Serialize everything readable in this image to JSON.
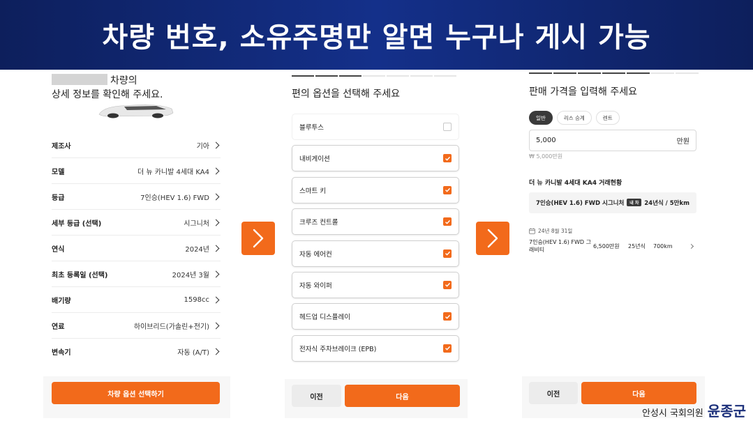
{
  "banner": {
    "title": "차량 번호, 소유주명만 알면 누구나 게시 가능"
  },
  "panel1": {
    "heading_line1": "차량의",
    "heading_line2": "상세 정보를 확인해 주세요.",
    "rows": [
      {
        "label": "제조사",
        "value": "기아"
      },
      {
        "label": "모델",
        "value": "더 뉴 카니발 4세대 KA4"
      },
      {
        "label": "등급",
        "value": "7인승(HEV 1.6) FWD"
      },
      {
        "label": "세부 등급 (선택)",
        "value": "시그니처"
      },
      {
        "label": "연식",
        "value": "2024년"
      },
      {
        "label": "최초 등록일 (선택)",
        "value": "2024년 3월"
      },
      {
        "label": "배기량",
        "value": "1598cc"
      },
      {
        "label": "연료",
        "value": "하이브리드(가솔린+전기)"
      },
      {
        "label": "변속기",
        "value": "자동 (A/T)"
      }
    ],
    "button_label": "차량 옵션 선택하기"
  },
  "panel2": {
    "title": "편의 옵션을 선택해 주세요",
    "options": [
      {
        "label": "블루투스",
        "checked": false
      },
      {
        "label": "내비게이션",
        "checked": true
      },
      {
        "label": "스마트 키",
        "checked": true
      },
      {
        "label": "크루즈 컨트롤",
        "checked": true
      },
      {
        "label": "자동 에어컨",
        "checked": true
      },
      {
        "label": "자동 와이퍼",
        "checked": true
      },
      {
        "label": "헤드업 디스플레이",
        "checked": true
      },
      {
        "label": "전자식 주차브레이크 (EPB)",
        "checked": true
      }
    ],
    "prev_label": "이전",
    "next_label": "다음"
  },
  "panel3": {
    "title": "판매 가격을 입력해 주세요",
    "tabs": [
      "일반",
      "리스 승계",
      "렌트"
    ],
    "active_tab": 0,
    "price_value": "5,000",
    "price_unit": "만원",
    "price_hint": "₩ 5,000만원",
    "trade_title": "더 뉴 카니발 4세대 KA4 거래현황",
    "trade_bar": {
      "trim": "7인승(HEV 1.6) FWD 시그니처",
      "badge": "내 차",
      "summary": "24년식 / 5만km"
    },
    "record": {
      "date": "24년 8월 31일",
      "name": "7인승(HEV 1.6) FWD 그래비티",
      "price": "6,500만원",
      "year": "25년식",
      "km": "700km"
    },
    "prev_label": "이전",
    "next_label": "다음"
  },
  "signature": {
    "small": "안성시 국회의원",
    "name": "윤종군"
  },
  "colors": {
    "accent": "#f26a1b",
    "banner": "#14308a"
  }
}
